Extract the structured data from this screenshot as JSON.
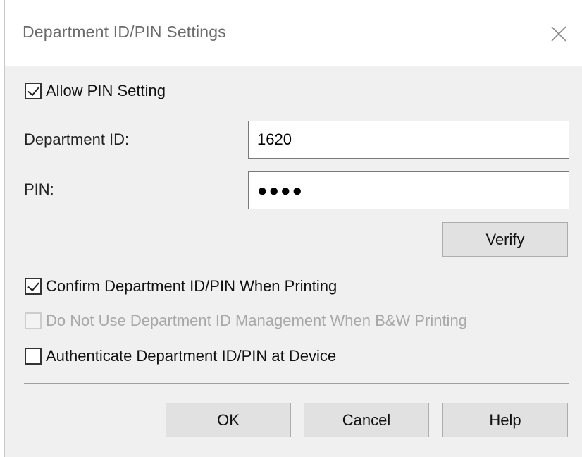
{
  "dialog": {
    "title": "Department ID/PIN Settings",
    "close_icon": "close-icon"
  },
  "allow_pin": {
    "label": "Allow PIN Setting",
    "checked": true
  },
  "department_id": {
    "label": "Department ID:",
    "value": "1620"
  },
  "pin": {
    "label": "PIN:",
    "masked_value": "●●●●"
  },
  "verify_button": {
    "label": "Verify"
  },
  "options": [
    {
      "label": "Confirm Department ID/PIN When Printing",
      "checked": true,
      "enabled": true
    },
    {
      "label": "Do Not Use Department ID Management When B&W Printing",
      "checked": false,
      "enabled": false
    },
    {
      "label": "Authenticate Department ID/PIN at Device",
      "checked": false,
      "enabled": true
    }
  ],
  "footer": {
    "ok_label": "OK",
    "cancel_label": "Cancel",
    "help_label": "Help"
  }
}
